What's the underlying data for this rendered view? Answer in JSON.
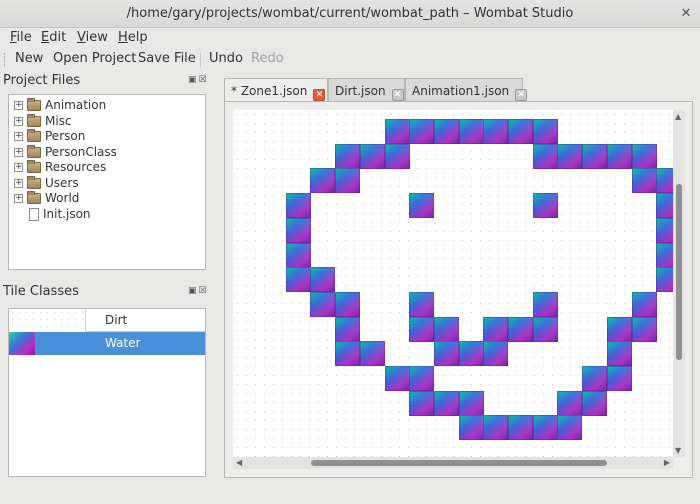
{
  "window": {
    "title": "/home/gary/projects/wombat/current/wombat_path – Wombat Studio",
    "close_glyph": "✕"
  },
  "menubar": {
    "file": {
      "mnemonic": "F",
      "rest": "ile"
    },
    "edit": {
      "mnemonic": "E",
      "rest": "dit"
    },
    "view": {
      "mnemonic": "V",
      "rest": "iew"
    },
    "help": {
      "mnemonic": "H",
      "rest": "elp"
    }
  },
  "toolbar": {
    "new": "New",
    "open_project": "Open Project",
    "save_file": "Save File",
    "undo": "Undo",
    "redo": "Redo"
  },
  "project_files": {
    "title": "Project Files",
    "dock_buttons": "▣☒",
    "items": [
      {
        "label": "Animation",
        "icon": "folder-icon",
        "expander": "+"
      },
      {
        "label": "Misc",
        "icon": "folder-icon",
        "expander": "+"
      },
      {
        "label": "Person",
        "icon": "folder-icon",
        "expander": "+"
      },
      {
        "label": "PersonClass",
        "icon": "folder-icon",
        "expander": "+"
      },
      {
        "label": "Resources",
        "icon": "folder-icon",
        "expander": "+"
      },
      {
        "label": "Users",
        "icon": "folder-icon",
        "expander": "+"
      },
      {
        "label": "World",
        "icon": "folder-icon",
        "expander": "+"
      },
      {
        "label": "Init.json",
        "icon": "file-icon",
        "expander": ""
      }
    ]
  },
  "tile_classes": {
    "title": "Tile Classes",
    "dock_buttons": "▣☒",
    "rows": [
      {
        "name": "Dirt",
        "selected": false
      },
      {
        "name": "Water",
        "selected": true
      }
    ]
  },
  "tabs": [
    {
      "label": "* Zone1.json",
      "active": true,
      "close": "✕"
    },
    {
      "label": "Dirt.json",
      "active": false,
      "close": "✕"
    },
    {
      "label": "Animation1.json",
      "active": false,
      "close": "✕"
    }
  ],
  "scroll_arrows": {
    "left": "◀",
    "right": "▶",
    "up": "▲",
    "down": "▼"
  },
  "colors": {
    "selection": "#4a90d9",
    "close_active": "#e0603c"
  }
}
